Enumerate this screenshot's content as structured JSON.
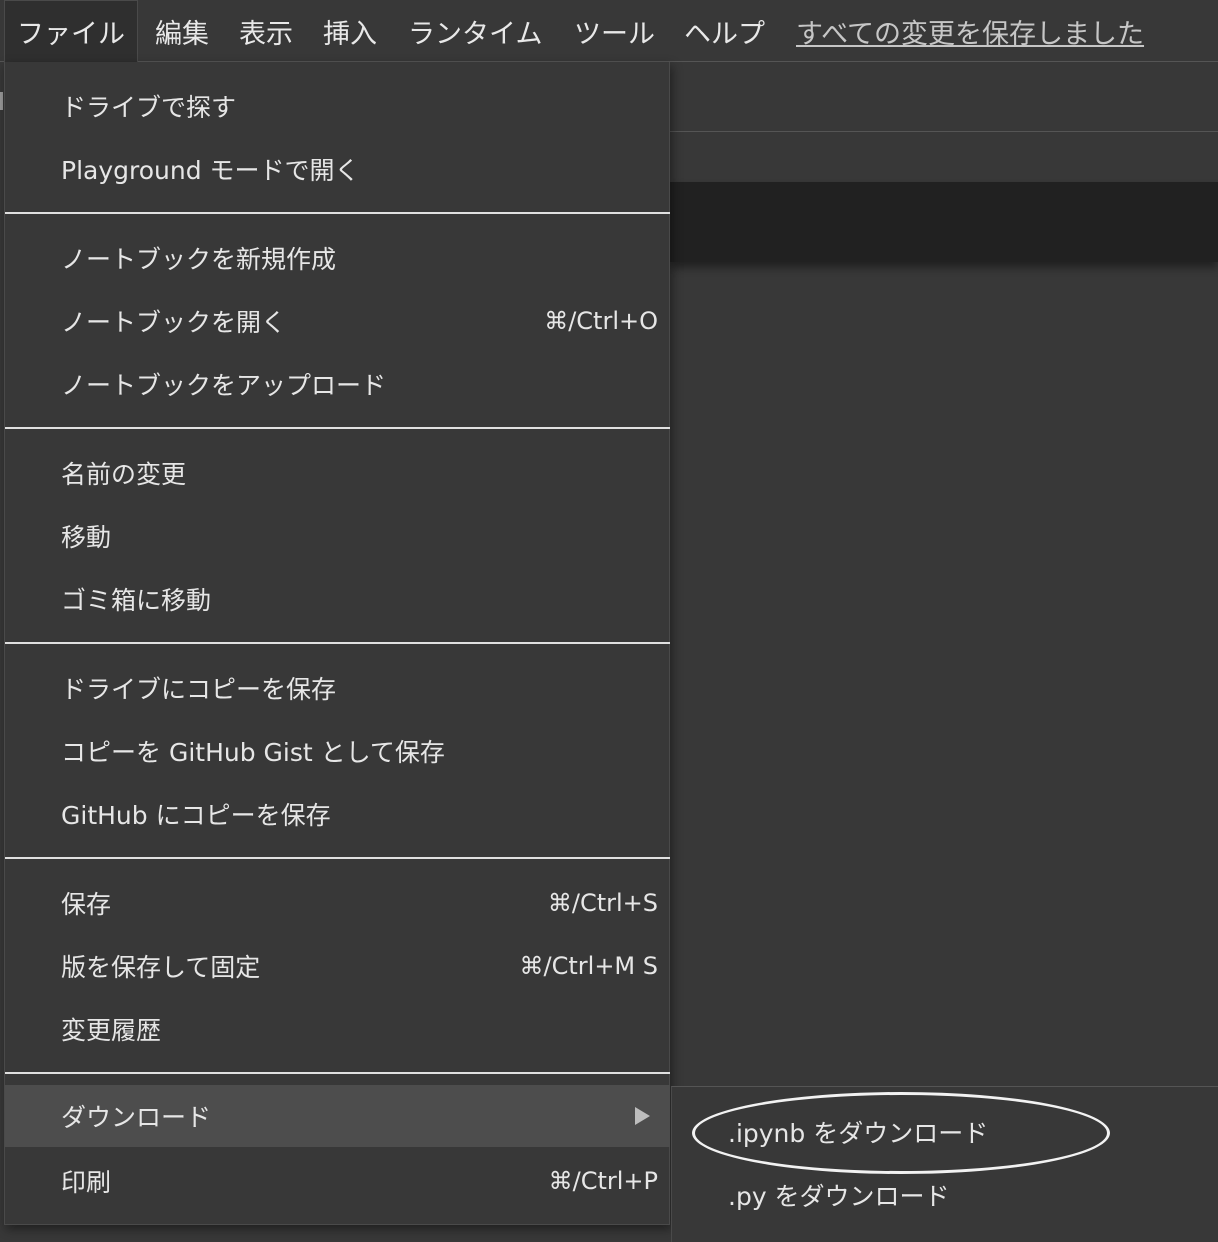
{
  "menubar": {
    "items": [
      "ファイル",
      "編集",
      "表示",
      "挿入",
      "ランタイム",
      "ツール",
      "ヘルプ"
    ],
    "save_status": "すべての変更を保存しました"
  },
  "file_menu": {
    "items": [
      {
        "label": "ドライブで探す",
        "shortcut": ""
      },
      {
        "label": "Playground モードで開く",
        "shortcut": ""
      },
      {
        "label": "ノートブックを新規作成",
        "shortcut": ""
      },
      {
        "label": "ノートブックを開く",
        "shortcut": "⌘/Ctrl+O"
      },
      {
        "label": "ノートブックをアップロード",
        "shortcut": ""
      },
      {
        "label": "名前の変更",
        "shortcut": ""
      },
      {
        "label": "移動",
        "shortcut": ""
      },
      {
        "label": "ゴミ箱に移動",
        "shortcut": ""
      },
      {
        "label": "ドライブにコピーを保存",
        "shortcut": ""
      },
      {
        "label": "コピーを GitHub Gist として保存",
        "shortcut": ""
      },
      {
        "label": "GitHub にコピーを保存",
        "shortcut": ""
      },
      {
        "label": "保存",
        "shortcut": "⌘/Ctrl+S"
      },
      {
        "label": "版を保存して固定",
        "shortcut": "⌘/Ctrl+M S"
      },
      {
        "label": "変更履歴",
        "shortcut": ""
      },
      {
        "label": "ダウンロード",
        "shortcut": ""
      },
      {
        "label": "印刷",
        "shortcut": "⌘/Ctrl+P"
      }
    ]
  },
  "download_submenu": {
    "items": [
      ".ipynb をダウンロード",
      ".py をダウンロード"
    ]
  }
}
